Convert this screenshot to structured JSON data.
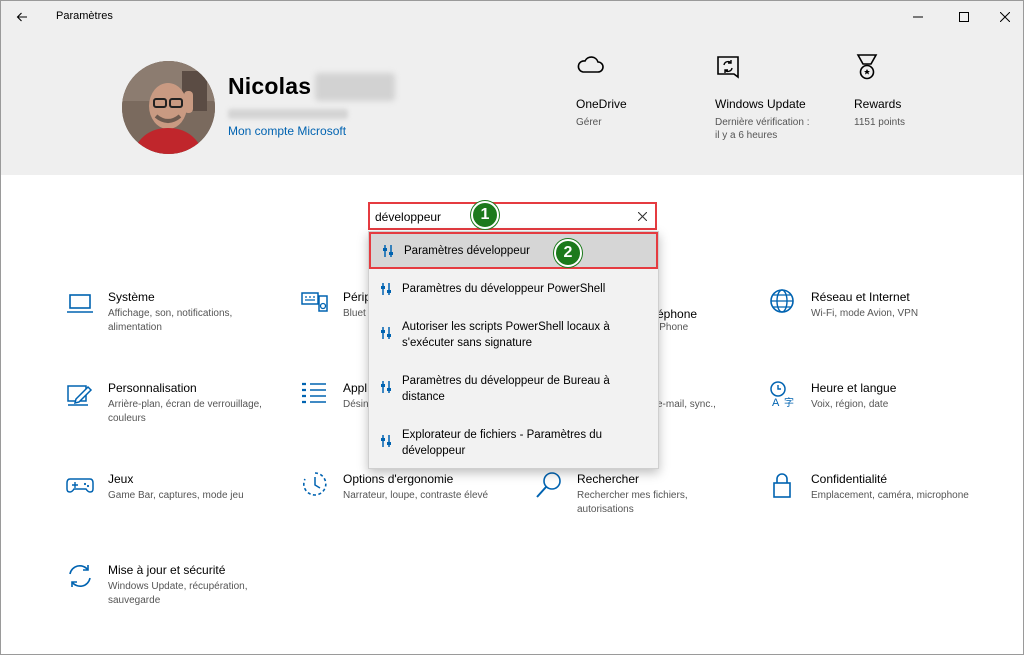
{
  "window": {
    "title": "Paramètres"
  },
  "profile": {
    "name": "Nicolas",
    "account_link": "Mon compte Microsoft"
  },
  "header_items": [
    {
      "title": "OneDrive",
      "subtitle": "Gérer",
      "icon": "cloud-icon"
    },
    {
      "title": "Windows Update",
      "subtitle": "Dernière vérification : il y a 6 heures",
      "icon": "windows-update-icon"
    },
    {
      "title": "Rewards",
      "subtitle": "1151 points",
      "icon": "medal-icon"
    }
  ],
  "search": {
    "value": "développeur",
    "placeholder": ""
  },
  "badges": {
    "one": "1",
    "two": "2"
  },
  "suggestions": [
    {
      "label": "Paramètres développeur"
    },
    {
      "label": "Paramètres du développeur PowerShell"
    },
    {
      "label": "Autoriser les scripts PowerShell locaux à s'exécuter sans signature"
    },
    {
      "label": "Paramètres du développeur de Bureau à distance"
    },
    {
      "label": "Explorateur de fichiers - Paramètres du développeur"
    }
  ],
  "tiles": [
    {
      "title": "Système",
      "subtitle": "Affichage, son, notifications, alimentation"
    },
    {
      "title": "Périp",
      "subtitle": "Bluet"
    },
    {
      "title": "éphone",
      "subtitle": "iPhone"
    },
    {
      "title": "Réseau et Internet",
      "subtitle": "Wi-Fi, mode Avion, VPN"
    },
    {
      "title": "Personnalisation",
      "subtitle": "Arrière-plan, écran de verrouillage, couleurs"
    },
    {
      "title": "Appl",
      "subtitle": "Désin"
    },
    {
      "title": "",
      "subtitle": "e-mail, sync.,"
    },
    {
      "title": "Heure et langue",
      "subtitle": "Voix, région, date"
    },
    {
      "title": "Jeux",
      "subtitle": "Game Bar, captures, mode jeu"
    },
    {
      "title": "Options d'ergonomie",
      "subtitle": "Narrateur, loupe, contraste élevé"
    },
    {
      "title": "Rechercher",
      "subtitle": "Rechercher mes fichiers, autorisations"
    },
    {
      "title": "Confidentialité",
      "subtitle": "Emplacement, caméra, microphone"
    },
    {
      "title": "Mise à jour et sécurité",
      "subtitle": "Windows Update, récupération, sauvegarde"
    }
  ],
  "colors": {
    "accent": "#0063b1",
    "highlight_border": "#e53b40",
    "badge": "#1c7a1c",
    "header_bg": "#efefef"
  }
}
